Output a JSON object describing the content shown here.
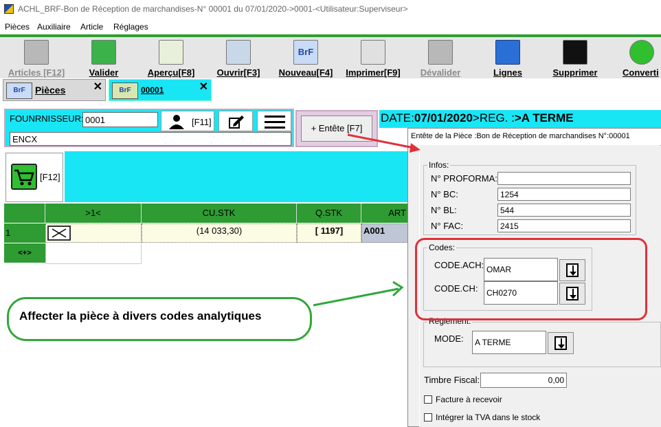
{
  "window": {
    "title": "ACHL_BRF-Bon de Réception de marchandises-N° 00001 du 07/01/2020->0001-<Utilisateur:Superviseur>"
  },
  "menu": [
    "Pièces",
    "Auxiliaire",
    "Article",
    "Réglages"
  ],
  "toolbar": {
    "articles": "Articles [F12]",
    "valider": "Valider",
    "apercu": "Aperçu[F8]",
    "ouvrir": "Ouvrir[F3]",
    "nouveau": "Nouveau[F4]",
    "nouveau_icon_text": "BrF",
    "imprimer": "Imprimer[F9]",
    "devalider": "Dévalider",
    "lignes": "Lignes",
    "supprimer": "Supprimer",
    "convertir": "Converti"
  },
  "tabs": {
    "pieces": {
      "icon_text": "BrF",
      "label": "Pièces",
      "close": "✕"
    },
    "document": {
      "icon_text": "BrF",
      "label": "00001",
      "close": "✕"
    }
  },
  "header": {
    "supplier_label": "FOUNRNISSEUR:",
    "supplier_code": "0001",
    "supplier_name": "ENCX",
    "person_key": "[F11]",
    "entete_button": "+ Entête [F7]",
    "date_prefix": "DATE:",
    "date_value": "07/01/2020",
    "reg_prefix": ">REG. :",
    "reg_value": ">A TERME",
    "cart_key": "[F12]"
  },
  "grid": {
    "columns": [
      "",
      ">1<",
      "CU.STK",
      "Q.STK",
      "ART"
    ],
    "rows": [
      {
        "num": "1",
        "cu_stk": "(14 033,30)",
        "q_stk": "[ 1197]",
        "art": "A001"
      }
    ],
    "nav": "<+>"
  },
  "dialog": {
    "title": "Entête de la Pièce :Bon de Réception de marchandises N°:00001",
    "infos": {
      "title": "Infos:",
      "fields": [
        {
          "label": "N° PROFORMA:",
          "value": ""
        },
        {
          "label": "N° BC:",
          "value": "1254"
        },
        {
          "label": "N° BL:",
          "value": "544"
        },
        {
          "label": "N° FAC:",
          "value": "2415"
        }
      ]
    },
    "codes": {
      "title": "Codes:",
      "fields": [
        {
          "label": "CODE.ACH:",
          "value": "OMAR"
        },
        {
          "label": "CODE.CH:",
          "value": "CH0270"
        }
      ]
    },
    "reglement": {
      "title": "Réglement:",
      "mode_label": "MODE:",
      "mode_value": "A TERME"
    },
    "timbre_label": "Timbre Fiscal:",
    "timbre_value": "0,00",
    "facture_label": "Facture à recevoir",
    "tva_label": "Intégrer la TVA dans le stock"
  },
  "annotation": {
    "text": "Affecter la pièce à divers codes analytiques"
  },
  "colors": {
    "toolbar_green": "#2f9e31",
    "cyan": "#19e6f5",
    "grid_green": "#2e9b33",
    "highlight_red": "#e0303a",
    "annotation_green": "#2fa83a"
  }
}
